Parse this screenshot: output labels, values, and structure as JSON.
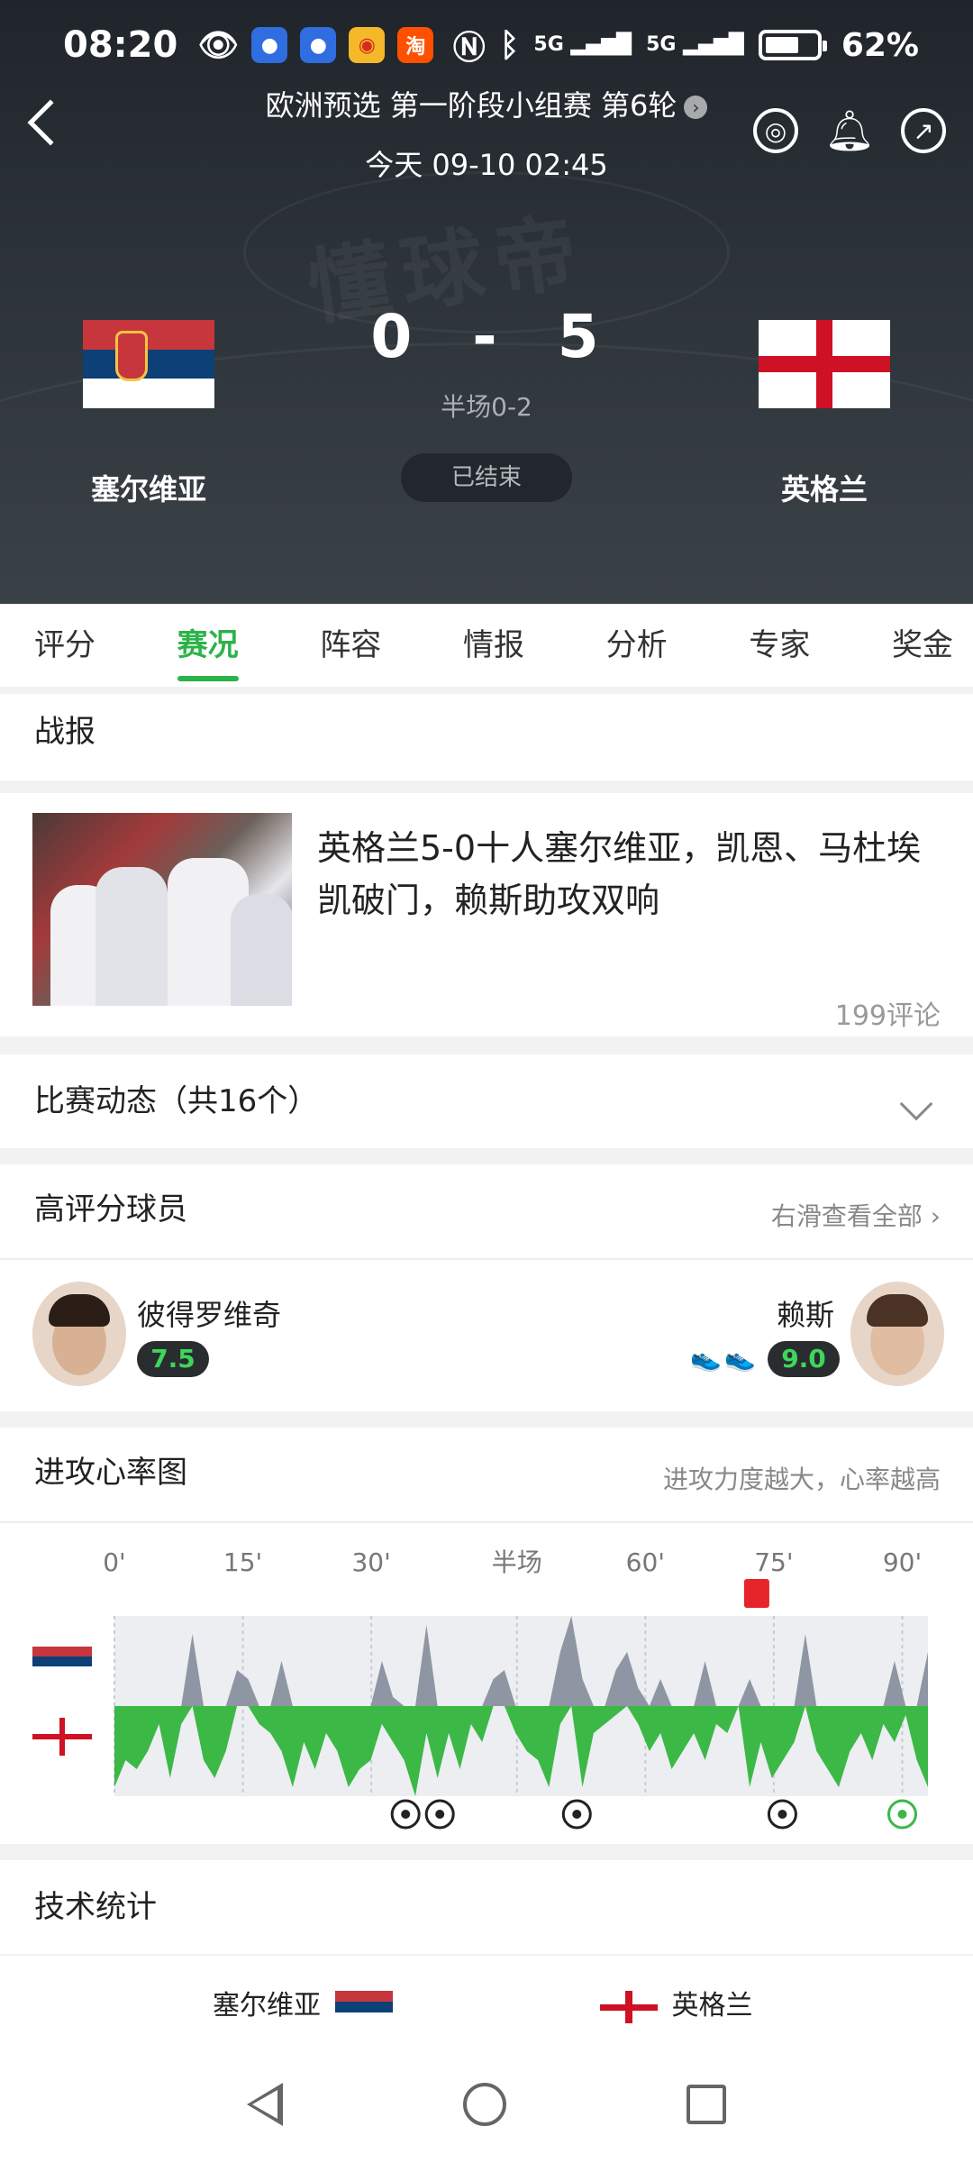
{
  "status_bar": {
    "time": "08:20",
    "network1": "5G",
    "network2": "5G",
    "battery": "62%"
  },
  "header": {
    "competition": "欧洲预选 第一阶段小组赛 第6轮",
    "datetime": "今天 09-10 02:45",
    "watermark": "懂球帝",
    "home_team": "塞尔维亚",
    "away_team": "英格兰",
    "home_score": "0",
    "score_sep": "-",
    "away_score": "5",
    "halftime": "半场0-2",
    "match_status": "已结束"
  },
  "tabs": [
    {
      "label": "评分"
    },
    {
      "label": "赛况"
    },
    {
      "label": "阵容"
    },
    {
      "label": "情报"
    },
    {
      "label": "分析"
    },
    {
      "label": "专家"
    },
    {
      "label": "奖金"
    }
  ],
  "report": {
    "section_title": "战报",
    "headline": "英格兰5-0十人塞尔维亚，凯恩、马杜埃凯破门，赖斯助攻双响",
    "comments": "199评论"
  },
  "events": {
    "title": "比赛动态（共16个）"
  },
  "top_players": {
    "title": "高评分球员",
    "hint": "右滑查看全部",
    "home_player": {
      "name": "彼得罗维奇",
      "rating": "7.5"
    },
    "away_player": {
      "name": "赖斯",
      "rating": "9.0"
    }
  },
  "heart_rate": {
    "title": "进攻心率图",
    "hint": "进攻力度越大，心率越高",
    "time_labels": [
      "0'",
      "15'",
      "30'",
      "半场",
      "60'",
      "75'",
      "90'"
    ],
    "home_values": [
      0,
      0,
      0,
      0,
      0,
      0,
      0,
      0.8,
      0,
      0,
      0,
      0.4,
      0.3,
      0,
      0,
      0.5,
      0,
      0,
      0,
      0,
      0,
      0,
      0,
      0,
      0.5,
      0.1,
      0,
      0,
      0.9,
      0,
      0,
      0,
      0,
      0,
      0.3,
      0.4,
      0,
      0,
      0,
      0,
      0.6,
      1.0,
      0.3,
      0,
      0,
      0.4,
      0.6,
      0.2,
      0,
      0.3,
      0,
      0,
      0,
      0.5,
      0,
      0,
      0,
      0.3,
      0,
      0,
      0,
      0,
      0.8,
      0,
      0,
      0,
      0,
      0,
      0,
      0,
      0.5,
      0,
      0,
      0.6
    ],
    "away_values": [
      0.9,
      0.6,
      0.7,
      0.5,
      0.2,
      0.8,
      0.2,
      0,
      0.6,
      0.8,
      0.5,
      0,
      0,
      0.2,
      0.3,
      0.5,
      0.9,
      0.4,
      0.7,
      0.3,
      0.5,
      0.9,
      0.7,
      0.6,
      0.2,
      0.4,
      0.6,
      1.0,
      0.3,
      0.8,
      0.3,
      0.7,
      0.2,
      0.4,
      0,
      0,
      0.3,
      0.5,
      0.6,
      0.9,
      0.2,
      0,
      0.9,
      0.3,
      0.2,
      0.1,
      0,
      0.2,
      0.5,
      0.3,
      0.7,
      0.5,
      0.3,
      0.6,
      0.2,
      0.3,
      0,
      0.9,
      0.4,
      0.8,
      0.6,
      0.4,
      0,
      0.5,
      0.7,
      0.9,
      0.5,
      0.3,
      0.6,
      0.2,
      0.4,
      0.1,
      0.6,
      0.9
    ],
    "goal_minutes": [
      34,
      38,
      54,
      78,
      92
    ],
    "red_card_minute": 75,
    "home_color": "#8f96a3",
    "away_color": "#3cb847",
    "goal_color_last": "#3cb847"
  },
  "tech_stats": {
    "title": "技术统计",
    "home_team": "塞尔维亚",
    "away_team": "英格兰"
  }
}
